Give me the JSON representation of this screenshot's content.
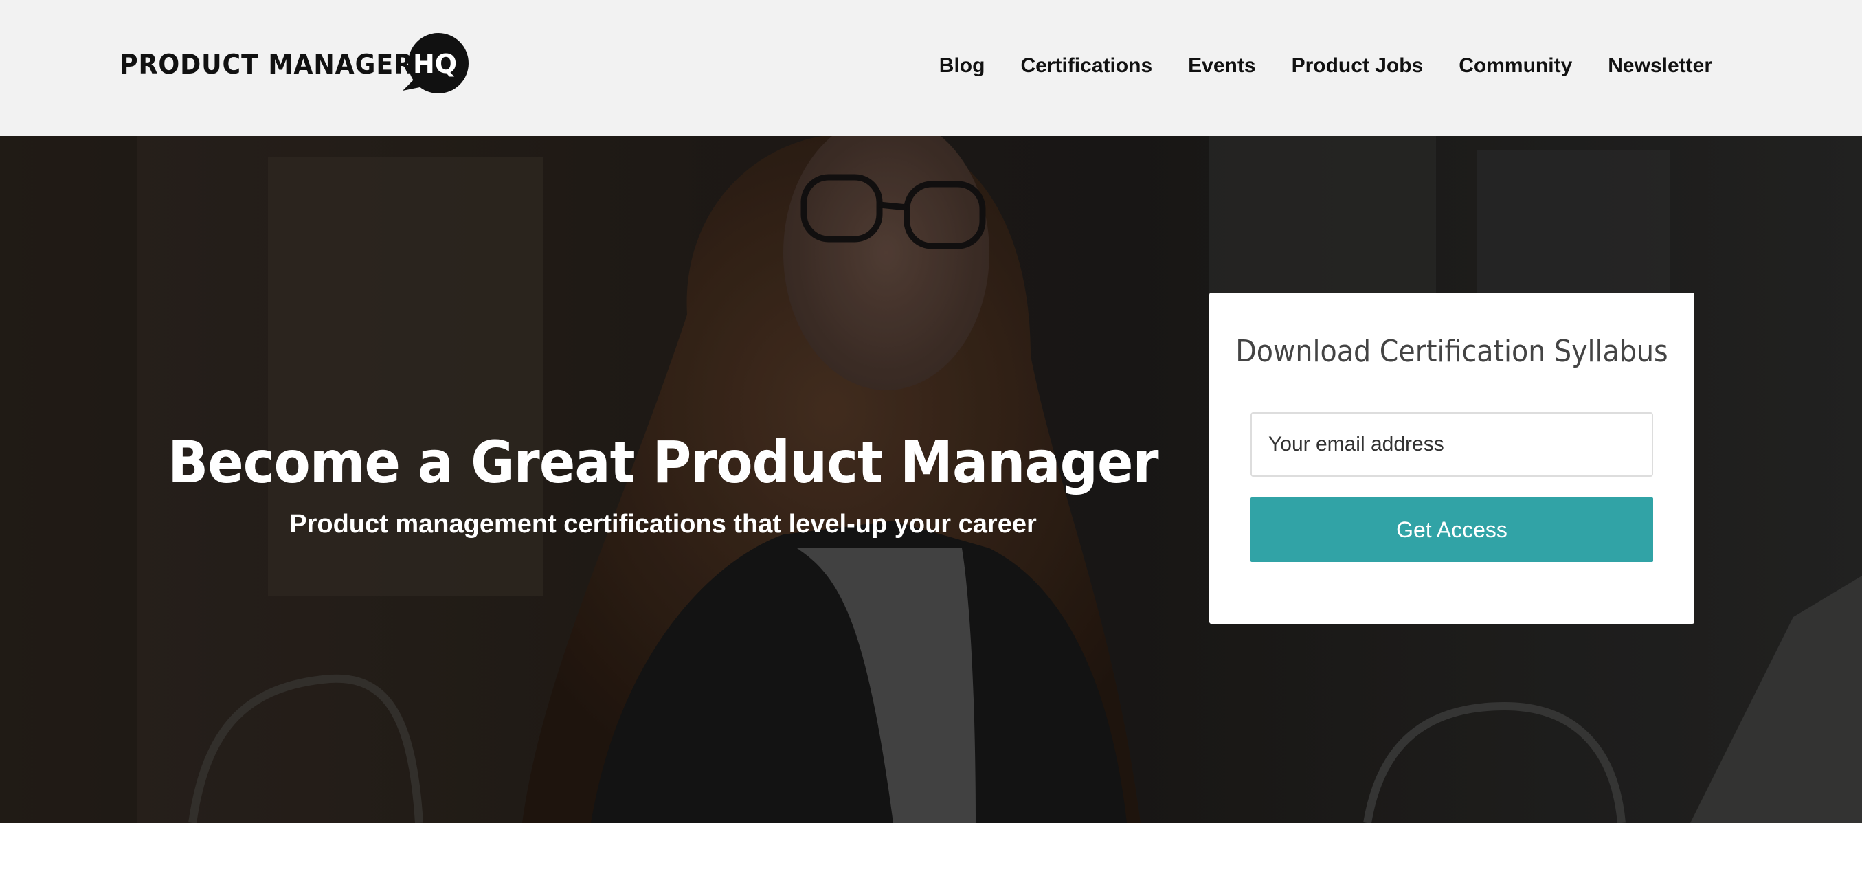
{
  "header": {
    "logo_text": "PRODUCT MANAGER",
    "logo_badge": "HQ",
    "nav": [
      {
        "label": "Blog"
      },
      {
        "label": "Certifications"
      },
      {
        "label": "Events"
      },
      {
        "label": "Product Jobs"
      },
      {
        "label": "Community"
      },
      {
        "label": "Newsletter"
      }
    ]
  },
  "hero": {
    "title": "Become a Great Product Manager",
    "subtitle": "Product management certifications that level-up your career"
  },
  "form": {
    "title": "Download Certification Syllabus",
    "email_placeholder": "Your email address",
    "email_value": "",
    "button_label": "Get Access"
  },
  "colors": {
    "header_bg": "#f2f2f2",
    "accent": "#31a3a6",
    "text_dark": "#111111",
    "card_title": "#444444"
  },
  "icons": {
    "logo": "speech-bubble-hq-logo"
  }
}
